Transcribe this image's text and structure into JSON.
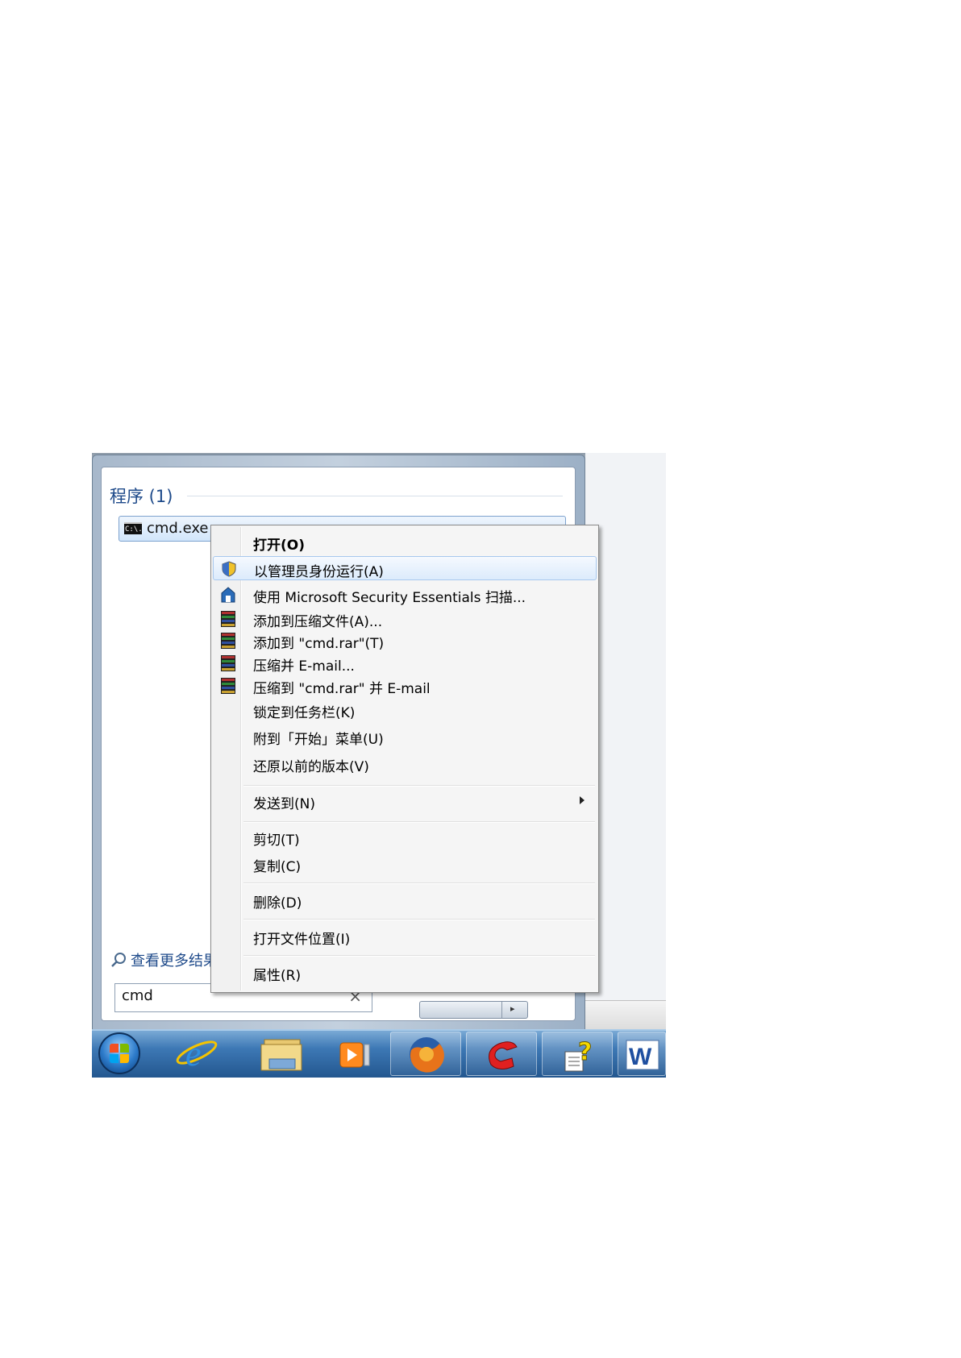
{
  "start_menu": {
    "group_title": "程序 (1)",
    "result": {
      "label": "cmd.exe",
      "icon_text": "C:\\."
    },
    "see_more": "查看更多结果",
    "search": {
      "value": "cmd",
      "clear_glyph": "×"
    }
  },
  "context_menu": {
    "items": [
      {
        "label": "打开(O)",
        "icon": "",
        "bold": true
      },
      {
        "label": "以管理员身份运行(A)",
        "icon": "uac-shield-icon",
        "highlighted": true
      },
      {
        "label": "使用 Microsoft Security Essentials 扫描...",
        "icon": "security-essentials-icon"
      },
      {
        "label": "添加到压缩文件(A)...",
        "icon": "winrar-icon"
      },
      {
        "label": "添加到 \"cmd.rar\"(T)",
        "icon": "winrar-icon"
      },
      {
        "label": "压缩并 E-mail...",
        "icon": "winrar-icon"
      },
      {
        "label": "压缩到 \"cmd.rar\" 并 E-mail",
        "icon": "winrar-icon"
      },
      {
        "label": "锁定到任务栏(K)",
        "icon": ""
      },
      {
        "label": "附到「开始」菜单(U)",
        "icon": ""
      },
      {
        "label": "还原以前的版本(V)",
        "icon": ""
      },
      {
        "label": "发送到(N)",
        "icon": "",
        "submenu": true
      },
      {
        "label": "剪切(T)",
        "icon": ""
      },
      {
        "label": "复制(C)",
        "icon": ""
      },
      {
        "label": "删除(D)",
        "icon": ""
      },
      {
        "label": "打开文件位置(I)",
        "icon": ""
      },
      {
        "label": "属性(R)",
        "icon": ""
      }
    ]
  },
  "taskbar": {
    "pinned": [
      "start-orb",
      "internet-explorer-icon",
      "file-explorer-icon",
      "media-player-icon",
      "firefox-icon",
      "red-app-icon",
      "help-icon",
      "word-icon"
    ],
    "ie_glyph": "e",
    "word_glyph": "W",
    "help_glyph": "?"
  },
  "colors": {
    "accent_blue": "#1e4a8a",
    "highlight": "#dcebfc",
    "taskbar": "#3d78b5"
  }
}
